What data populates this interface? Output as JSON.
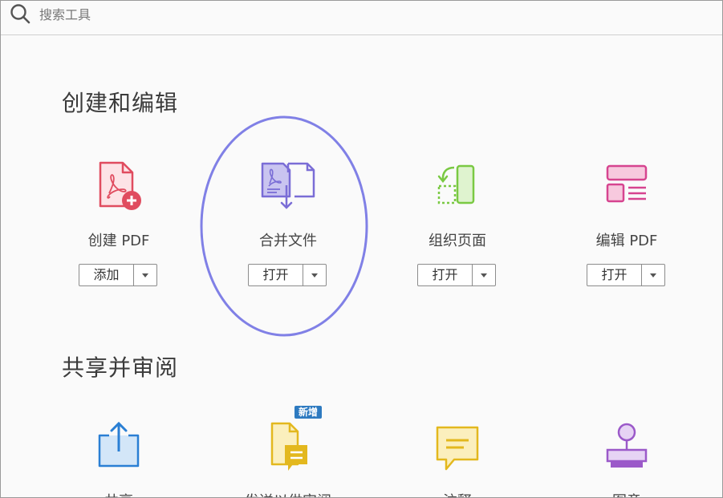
{
  "search": {
    "placeholder": "搜索工具"
  },
  "sections": [
    {
      "title": "创建和编辑",
      "tools": [
        {
          "label": "创建 PDF",
          "button": "添加",
          "icon": "create-pdf-icon",
          "color": "#e04c5f"
        },
        {
          "label": "合并文件",
          "button": "打开",
          "icon": "combine-files-icon",
          "color": "#7a6dd6"
        },
        {
          "label": "组织页面",
          "button": "打开",
          "icon": "organize-pages-icon",
          "color": "#7ac943"
        },
        {
          "label": "编辑 PDF",
          "button": "打开",
          "icon": "edit-pdf-icon",
          "color": "#d6448f"
        }
      ]
    },
    {
      "title": "共享并审阅",
      "tools": [
        {
          "label": "共享",
          "icon": "share-icon",
          "color": "#2a7fd4"
        },
        {
          "label": "发送以供审阅",
          "icon": "send-for-review-icon",
          "color": "#e3b81e",
          "badge": "新增"
        },
        {
          "label": "注释",
          "icon": "comment-icon",
          "color": "#e3b81e"
        },
        {
          "label": "图章",
          "icon": "stamp-icon",
          "color": "#9b59c9"
        }
      ]
    }
  ],
  "annotation": {
    "color": "#8080e6"
  }
}
